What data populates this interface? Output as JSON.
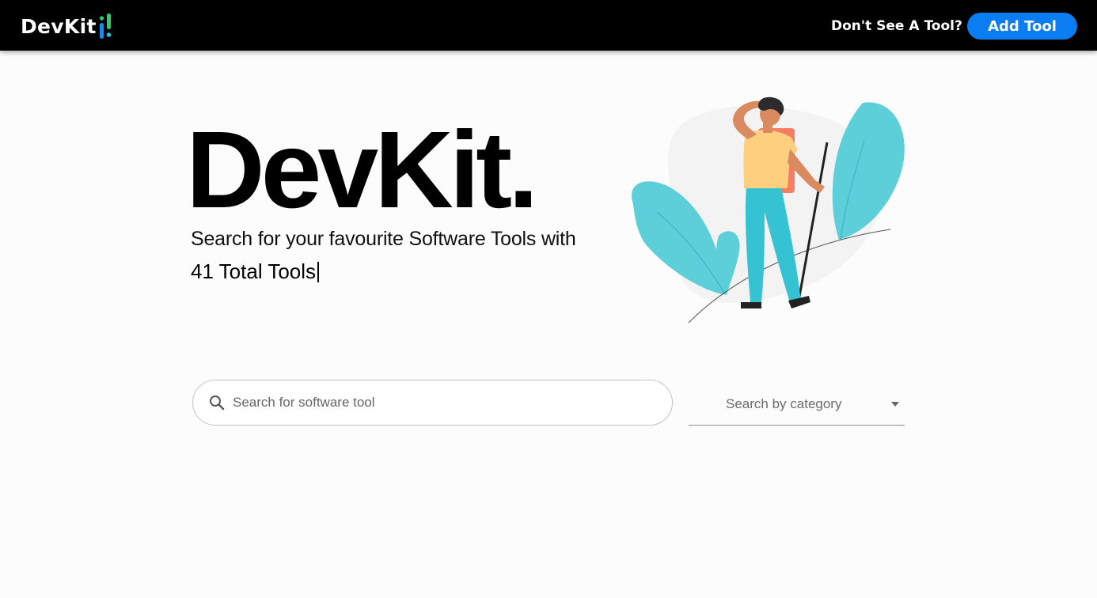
{
  "navbar": {
    "logo_text": "DevKit",
    "prompt": "Don't See A Tool?",
    "add_button": "Add Tool"
  },
  "hero": {
    "title": "DevKit.",
    "subtitle": "Search for your favourite Software Tools with",
    "count_text": "41 Total Tools"
  },
  "search": {
    "placeholder": "Search for software tool",
    "value": ""
  },
  "category": {
    "label": "Search by category"
  },
  "colors": {
    "accent": "#0b7df2",
    "navbar": "#000000",
    "plant": "#5ccfd9",
    "pants": "#35c2d3",
    "shirt": "#fdcf7f",
    "backpack": "#f47d62",
    "skin": "#d98a5f"
  },
  "icons": {
    "search": "search-icon",
    "dropdown": "chevron-down-icon",
    "logo": "devkit-logo-mark"
  }
}
